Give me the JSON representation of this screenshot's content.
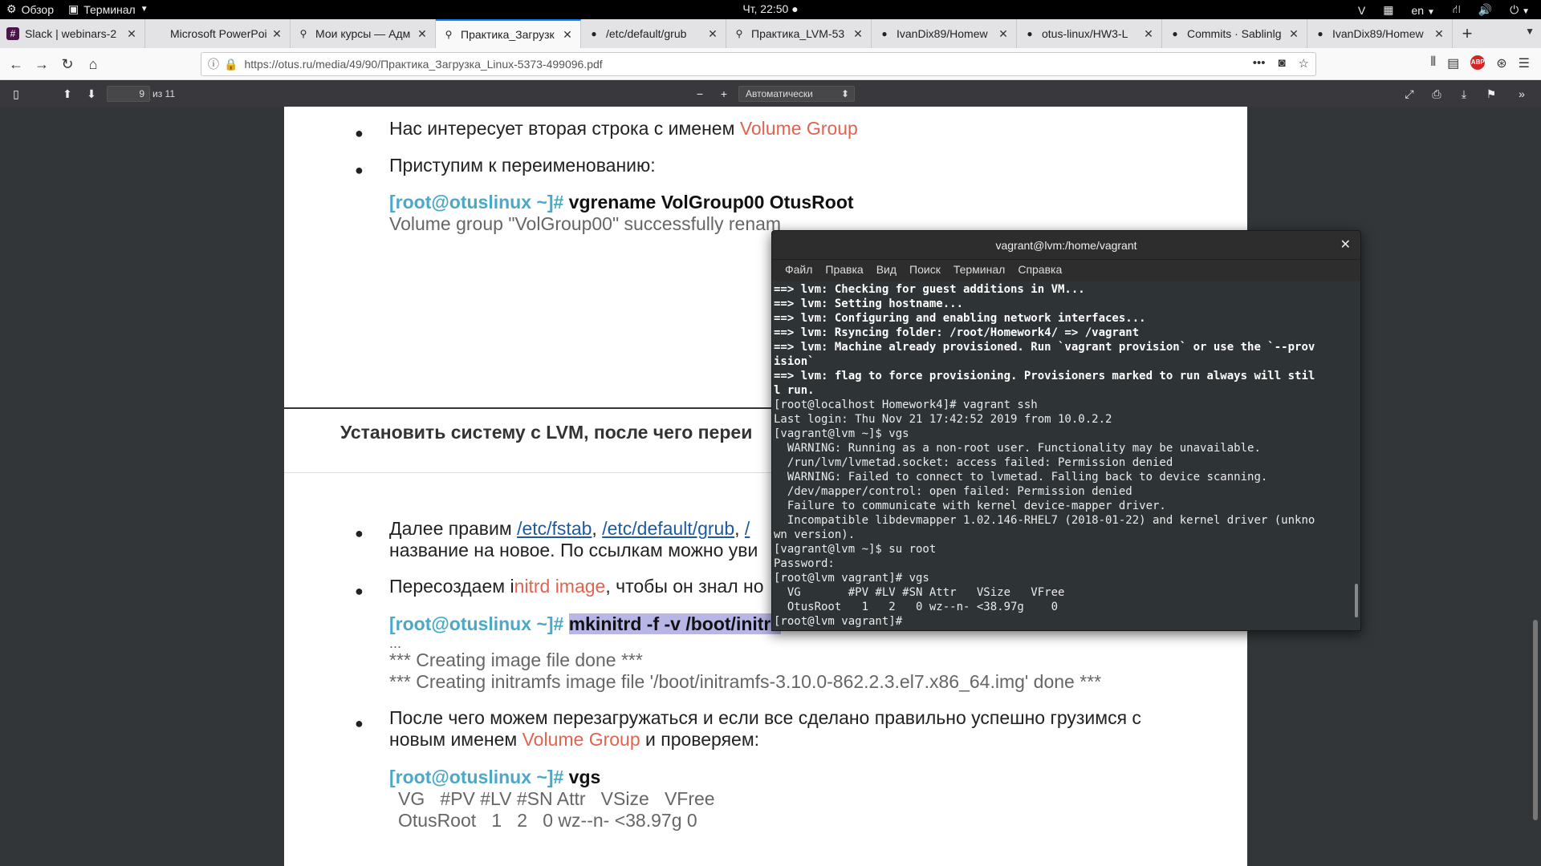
{
  "topbar": {
    "overview": "Обзор",
    "app": "Терминал",
    "clock": "Чт, 22:50 ●",
    "lang": "en"
  },
  "tabs": [
    {
      "title": "Slack | webinars-2",
      "icon": "slack-icon"
    },
    {
      "title": "Microsoft PowerPoint",
      "icon": "blank-icon"
    },
    {
      "title": "Мои курсы — Адм",
      "icon": "pin-icon"
    },
    {
      "title": "Практика_Загрузк",
      "icon": "pin-icon",
      "active": true
    },
    {
      "title": "/etc/default/grub",
      "icon": "github-icon"
    },
    {
      "title": "Практика_LVM-53",
      "icon": "pin-icon"
    },
    {
      "title": "IvanDix89/Homew",
      "icon": "github-icon"
    },
    {
      "title": "otus-linux/HW3-L",
      "icon": "github-icon"
    },
    {
      "title": "Commits · Sablinlg",
      "icon": "github-icon"
    },
    {
      "title": "IvanDix89/Homew",
      "icon": "github-icon"
    }
  ],
  "url": "https://otus.ru/media/49/90/Практика_Загрузка_Linux-5373-499096.pdf",
  "pdf": {
    "page": "9",
    "total": "из 11",
    "zoom": "Автоматически"
  },
  "page1": {
    "b1_text": "Нас интересует вторая строка с именем ",
    "b1_red": "Volume Group",
    "b2_text": "Приступим к переименованию:",
    "prompt": "[root@otuslinux ~]#",
    "cmd": " vgrename VolGroup00 OtusRoot",
    "output": "Volume group \"VolGroup00\" successfully renam"
  },
  "page2": {
    "heading": "Установить систему с LVM, после чего переи",
    "b1_pre": "Далее правим ",
    "link1": "/etc/fstab",
    "sep": ", ",
    "link2": "/etc/default/grub",
    "link3": "/",
    "b1_line2": "название на новое. По ссылкам можно уви",
    "b2_pre": "Пересоздаем i",
    "b2_red": "nitrd image",
    "b2_post": ", чтобы он знал но",
    "prompt": "[root@otuslinux ~]#",
    "cmd": "mkinitrd -f -v /boot/initra",
    "cmd_tail": "...",
    "out1": "*** Creating image file done ***",
    "out2": "*** Creating initramfs image file '/boot/initramfs-3.10.0-862.2.3.el7.x86_64.img' done ***",
    "b3_line1": "После чего можем перезагружаться и если все сделано правильно успешно грузимся с",
    "b3_pre": "новым именем ",
    "b3_red": "Volume Group",
    "b3_post": " и проверяем:",
    "prompt2": "[root@otuslinux ~]#",
    "cmd2": " vgs",
    "vgs_hdr": "VG   #PV #LV #SN Attr   VSize   VFree",
    "vgs_row": "OtusRoot   1   2   0 wz--n- <38.97g 0"
  },
  "terminal": {
    "title": "vagrant@lvm:/home/vagrant",
    "menu": [
      "Файл",
      "Правка",
      "Вид",
      "Поиск",
      "Терминал",
      "Справка"
    ],
    "lines": [
      {
        "t": "==> lvm: Checking for guest additions in VM...",
        "b": true
      },
      {
        "t": "==> lvm: Setting hostname...",
        "b": true
      },
      {
        "t": "==> lvm: Configuring and enabling network interfaces...",
        "b": true
      },
      {
        "t": "==> lvm: Rsyncing folder: /root/Homework4/ => /vagrant",
        "b": true
      },
      {
        "t": "==> lvm: Machine already provisioned. Run `vagrant provision` or use the `--prov",
        "b": true
      },
      {
        "t": "ision`",
        "b": true
      },
      {
        "t": "==> lvm: flag to force provisioning. Provisioners marked to run always will stil",
        "b": true
      },
      {
        "t": "l run.",
        "b": true
      },
      {
        "t": "[root@localhost Homework4]# vagrant ssh",
        "b": false
      },
      {
        "t": "Last login: Thu Nov 21 17:42:52 2019 from 10.0.2.2",
        "b": false
      },
      {
        "t": "[vagrant@lvm ~]$ vgs",
        "b": false
      },
      {
        "t": "  WARNING: Running as a non-root user. Functionality may be unavailable.",
        "b": false
      },
      {
        "t": "  /run/lvm/lvmetad.socket: access failed: Permission denied",
        "b": false
      },
      {
        "t": "  WARNING: Failed to connect to lvmetad. Falling back to device scanning.",
        "b": false
      },
      {
        "t": "  /dev/mapper/control: open failed: Permission denied",
        "b": false
      },
      {
        "t": "  Failure to communicate with kernel device-mapper driver.",
        "b": false
      },
      {
        "t": "  Incompatible libdevmapper 1.02.146-RHEL7 (2018-01-22) and kernel driver (unkno",
        "b": false
      },
      {
        "t": "wn version).",
        "b": false
      },
      {
        "t": "[vagrant@lvm ~]$ su root",
        "b": false
      },
      {
        "t": "Password:",
        "b": false
      },
      {
        "t": "[root@lvm vagrant]# vgs",
        "b": false
      },
      {
        "t": "  VG       #PV #LV #SN Attr   VSize   VFree",
        "b": false
      },
      {
        "t": "  OtusRoot   1   2   0 wz--n- <38.97g    0",
        "b": false
      },
      {
        "t": "[root@lvm vagrant]# ",
        "b": false
      }
    ]
  }
}
